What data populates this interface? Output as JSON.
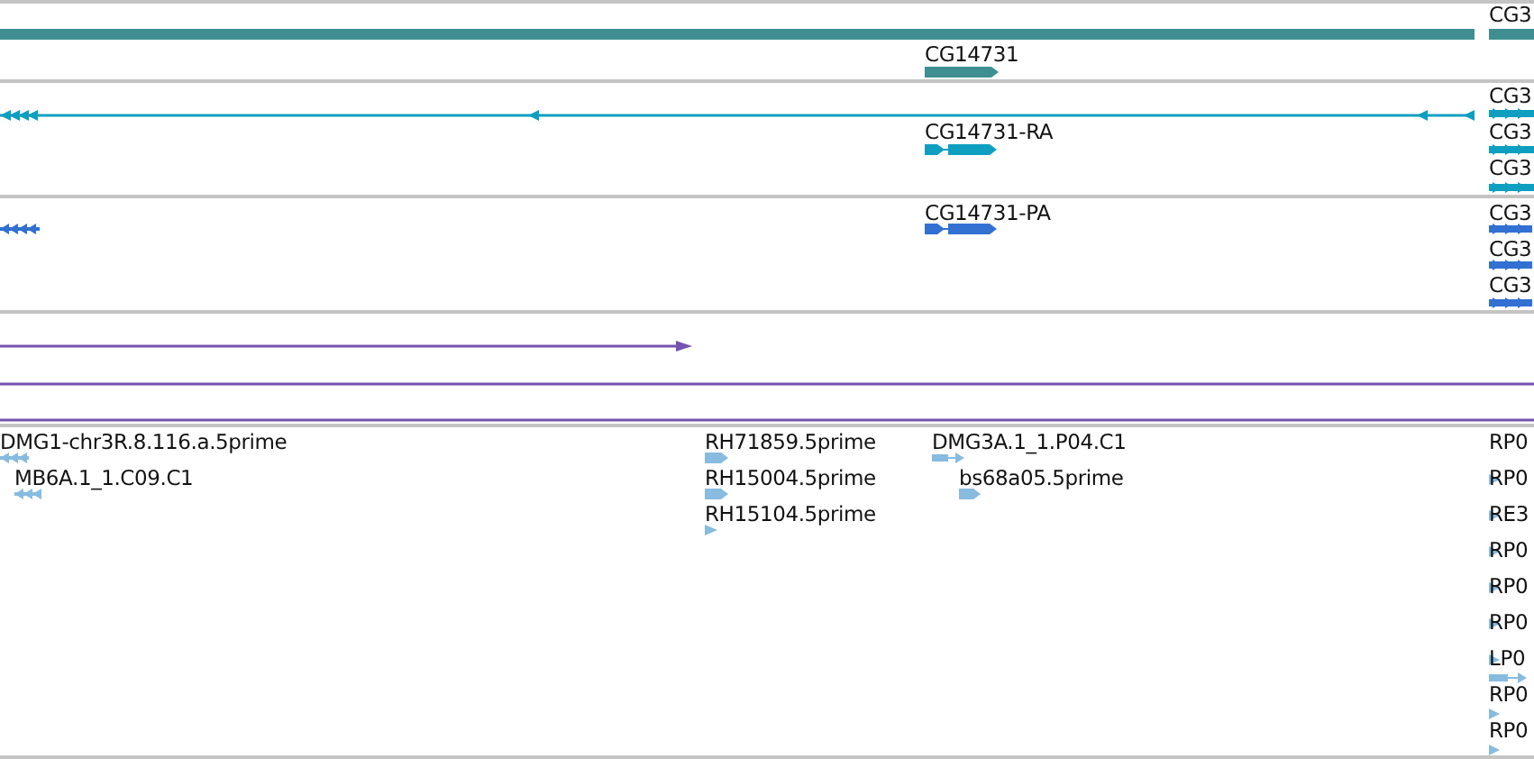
{
  "tracks": [
    {
      "color": "#3f8f92",
      "features": [
        {
          "kind": "bar"
        },
        {
          "label": "CG3",
          "kind": "bar"
        },
        {
          "label": "CG14731",
          "kind": "plus-block"
        }
      ]
    },
    {
      "color": "#0e9fc0",
      "features": [
        {
          "kind": "minus-line"
        },
        {
          "label": "CG3",
          "kind": "plus-multi"
        },
        {
          "label": "CG14731-RA",
          "kind": "plus-exons"
        },
        {
          "label": "CG3",
          "kind": "plus-multi"
        },
        {
          "label": "CG3",
          "kind": "plus-multi"
        }
      ]
    },
    {
      "color": "#3270d2",
      "features": [
        {
          "kind": "minus-multi"
        },
        {
          "label": "CG14731-PA",
          "kind": "plus-exons"
        },
        {
          "label": "CG3",
          "kind": "plus-multi"
        },
        {
          "label": "CG3",
          "kind": "plus-multi"
        },
        {
          "label": "CG3",
          "kind": "plus-multi"
        }
      ]
    },
    {
      "color": "#7353b0",
      "features": [
        {
          "kind": "plus-line"
        },
        {
          "kind": "line"
        },
        {
          "kind": "line"
        }
      ]
    },
    {
      "color": "#88bbe0",
      "features": [
        {
          "label": "DMG1-chr3R.8.116.a.5prime",
          "kind": "minus-multi"
        },
        {
          "label": "MB6A.1_1.C09.C1",
          "kind": "minus-multi"
        },
        {
          "label": "RH71859.5prime",
          "kind": "plus-block"
        },
        {
          "label": "RH15004.5prime",
          "kind": "plus-block"
        },
        {
          "label": "RH15104.5prime",
          "kind": "plus-point"
        },
        {
          "label": "DMG3A.1_1.P04.C1",
          "kind": "plus-intron"
        },
        {
          "label": "bs68a05.5prime",
          "kind": "plus-block"
        },
        {
          "label": "RP0",
          "kind": "plus-point"
        },
        {
          "label": "RP0",
          "kind": "plus-point"
        },
        {
          "label": "RE3",
          "kind": "plus-point"
        },
        {
          "label": "RP0",
          "kind": "plus-point"
        },
        {
          "label": "RP0",
          "kind": "plus-point"
        },
        {
          "label": "RP0",
          "kind": "plus-point"
        },
        {
          "label": "LP0",
          "kind": "plus-intron"
        },
        {
          "label": "RP0",
          "kind": "plus-point"
        },
        {
          "label": "RP0",
          "kind": "plus-point"
        }
      ]
    }
  ]
}
